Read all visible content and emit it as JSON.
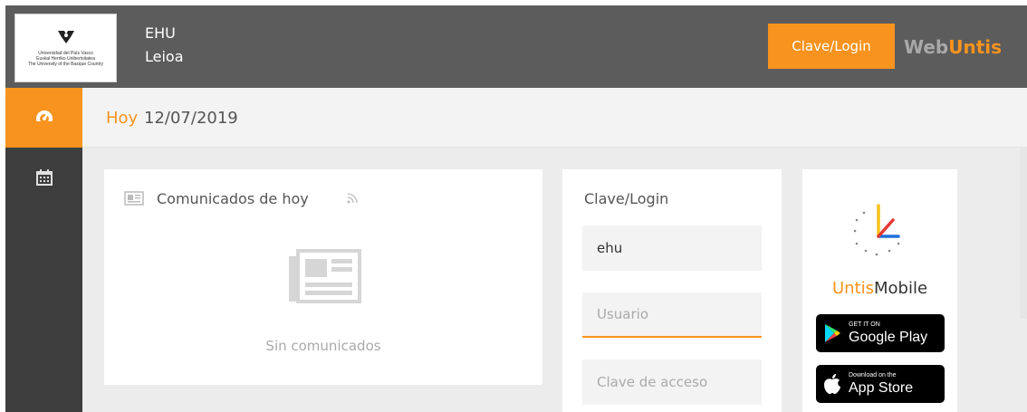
{
  "header": {
    "logo_lines": [
      "Universidad del País Vasco",
      "Euskal Herriko Unibertsitatea",
      "The University of the Basque Country"
    ],
    "school_name": "EHU",
    "school_city": "Leioa",
    "login_button": "Clave/Login",
    "brand_part1": "Web",
    "brand_part2": "Untis"
  },
  "sidebar": {
    "items": [
      {
        "icon": "dashboard-icon",
        "active": true
      },
      {
        "icon": "calendar-icon",
        "active": false
      }
    ]
  },
  "datebar": {
    "today_label": "Hoy",
    "date": "12/07/2019"
  },
  "news": {
    "title": "Comunicados de hoy",
    "empty_text": "Sin comunicados"
  },
  "login": {
    "title": "Clave/Login",
    "school_value": "ehu",
    "user_placeholder": "Usuario",
    "password_placeholder": "Clave de acceso"
  },
  "mobile": {
    "name_part1": "Untis",
    "name_part2": "Mobile",
    "google_small": "GET IT ON",
    "google_big": "Google Play",
    "apple_small": "Download on the",
    "apple_big": "App Store"
  },
  "colors": {
    "accent": "#f7931e",
    "header_bg": "#5c5c5c",
    "sidebar_bg": "#3e3e3e",
    "content_bg": "#ececec"
  }
}
